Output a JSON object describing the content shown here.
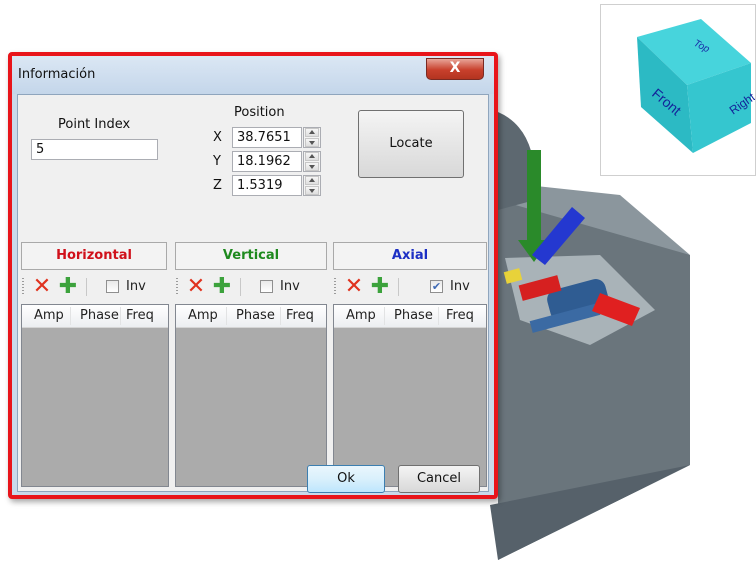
{
  "dialog": {
    "title": "Información",
    "close_glyph": "X",
    "point_index": {
      "label": "Point Index",
      "value": "5"
    },
    "position": {
      "label": "Position",
      "x": {
        "label": "X",
        "value": "38.7651"
      },
      "y": {
        "label": "Y",
        "value": "18.1962"
      },
      "z": {
        "label": "Z",
        "value": "1.5319"
      }
    },
    "locate_label": "Locate",
    "groups": [
      {
        "title": "Horizontal",
        "color": "#d0101a",
        "inv_label": "Inv",
        "inv_checked": false,
        "columns": [
          "Amp",
          "Phase",
          "Freq"
        ]
      },
      {
        "title": "Vertical",
        "color": "#1e8a1e",
        "inv_label": "Inv",
        "inv_checked": false,
        "columns": [
          "Amp",
          "Phase",
          "Freq"
        ]
      },
      {
        "title": "Axial",
        "color": "#1c2fc4",
        "inv_label": "Inv",
        "inv_checked": true,
        "columns": [
          "Amp",
          "Phase",
          "Freq"
        ]
      }
    ],
    "ok_label": "Ok",
    "cancel_label": "Cancel"
  },
  "view_cube": {
    "faces": [
      "Top",
      "Front",
      "Right"
    ]
  },
  "icons": {
    "delete": "x-icon",
    "add": "plus-icon",
    "close": "close-icon"
  }
}
